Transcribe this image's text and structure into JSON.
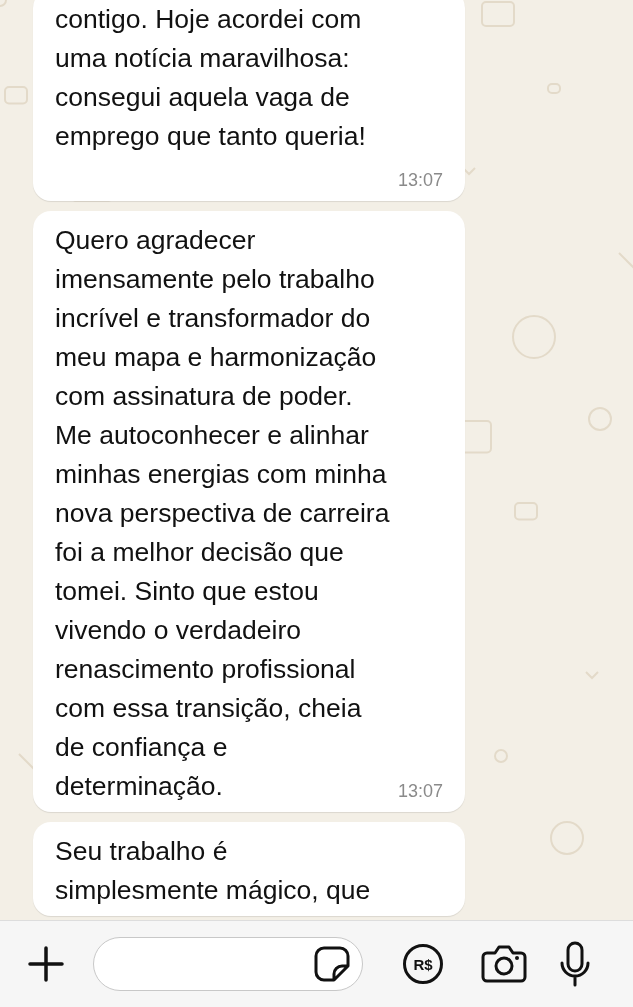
{
  "messages": [
    {
      "text": "contigo. Hoje acordei com\numa notícia maravilhosa:\nconsegui aquela vaga de\nemprego que tanto queria!",
      "time": "13:07"
    },
    {
      "text": "Quero agradecer\nimensamente pelo trabalho\nincrível e transformador do\nmeu mapa e harmonização\ncom assinatura de poder.\nMe autoconhecer e alinhar\nminhas energias com minha\nnova perspectiva de carreira\nfoi a melhor decisão que\ntomei. Sinto que estou\nvivendo o verdadeiro\nrenascimento profissional\ncom essa transição, cheia\nde confiança e\ndeterminação.",
      "time": "13:07"
    },
    {
      "text": "Seu trabalho é\nsimplesmente mágico, que"
    }
  ],
  "composer": {
    "payment_label": "R$"
  }
}
